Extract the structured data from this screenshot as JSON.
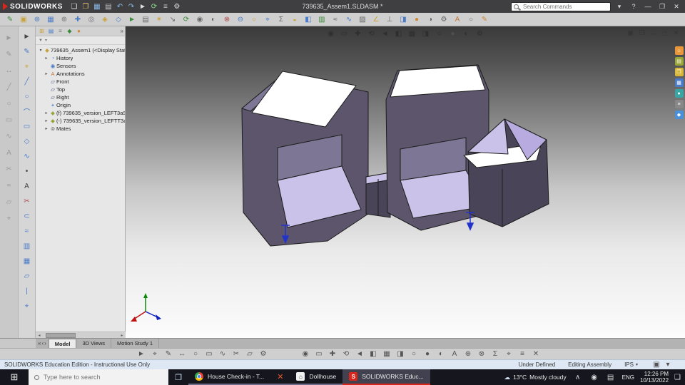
{
  "titlebar": {
    "doc_title": "739635_Assem1.SLDASM *",
    "app_name": "SOLIDWORKS",
    "search_placeholder": "Search Commands",
    "search_caret": "▾",
    "help": "?",
    "win_min": "—",
    "win_max": "❐",
    "win_close": "✕"
  },
  "toolbars": {
    "titlebar": [
      {
        "n": "new-file",
        "g": "❏",
        "c": "#e0e0e0"
      },
      {
        "n": "open-file",
        "g": "❐",
        "c": "#e8c87a"
      },
      {
        "n": "save",
        "g": "▦",
        "c": "#8ab8e8"
      },
      {
        "n": "print",
        "g": "▤",
        "c": "#c8c8c8"
      },
      {
        "n": "undo",
        "g": "↶",
        "c": "#8ab8e8"
      },
      {
        "n": "redo",
        "g": "↷",
        "c": "#8ab8e8"
      },
      {
        "n": "select",
        "g": "►",
        "c": "#e0e0e0"
      },
      {
        "n": "rebuild",
        "g": "⟳",
        "c": "#8adb8a"
      },
      {
        "n": "file-properties",
        "g": "≡",
        "c": "#c8c8c8"
      },
      {
        "n": "options",
        "g": "⚙",
        "c": "#d8d8d8"
      }
    ],
    "main": [
      {
        "n": "edit-component",
        "g": "✎",
        "c": "#3a8a3a"
      },
      {
        "n": "insert-components",
        "g": "▣",
        "c": "#caa23a"
      },
      {
        "n": "mate",
        "g": "⊚",
        "c": "#4a7bc7"
      },
      {
        "n": "linear-component-pattern",
        "g": "▦",
        "c": "#4a7bc7"
      },
      {
        "n": "smart-fasteners",
        "g": "⊕",
        "c": "#777"
      },
      {
        "n": "move-component",
        "g": "✚",
        "c": "#4a7bc7"
      },
      {
        "n": "show-hidden-components",
        "g": "◎",
        "c": "#777"
      },
      {
        "n": "assembly-features",
        "g": "◈",
        "c": "#caa23a"
      },
      {
        "n": "reference-geometry",
        "g": "◇",
        "c": "#4a7bc7"
      },
      {
        "n": "new-motion-study",
        "g": "►",
        "c": "#3a8a3a"
      },
      {
        "n": "bill-of-materials",
        "g": "▤",
        "c": "#666"
      },
      {
        "n": "exploded-view",
        "g": "✶",
        "c": "#caa23a"
      },
      {
        "n": "instant3d",
        "g": "↘",
        "c": "#666"
      },
      {
        "n": "update",
        "g": "⟳",
        "c": "#3a8a3a"
      },
      {
        "n": "take-snapshot",
        "g": "◉",
        "c": "#666"
      },
      {
        "n": "large-design-review",
        "g": "◐",
        "c": "#666"
      },
      {
        "n": "interference-detection",
        "g": "⊗",
        "c": "#b34a4a"
      },
      {
        "n": "clearance-verification",
        "g": "⊖",
        "c": "#4a7bc7"
      },
      {
        "n": "hole-alignment",
        "g": "○",
        "c": "#caa23a"
      },
      {
        "n": "measure",
        "g": "⌖",
        "c": "#4a7bc7"
      },
      {
        "n": "mass-properties",
        "g": "Σ",
        "c": "#666"
      },
      {
        "n": "sensor",
        "g": "◒",
        "c": "#caa23a"
      },
      {
        "n": "section-view",
        "g": "◧",
        "c": "#4a7bc7"
      },
      {
        "n": "assembly-visualization",
        "g": "▥",
        "c": "#3a8a3a"
      },
      {
        "n": "performance-evaluation",
        "g": "≈",
        "c": "#666"
      },
      {
        "n": "curvature",
        "g": "∿",
        "c": "#4a7bc7"
      },
      {
        "n": "zebra-stripes",
        "g": "▨",
        "c": "#666"
      },
      {
        "n": "draft-analysis",
        "g": "∠",
        "c": "#caa23a"
      },
      {
        "n": "undercut-analysis",
        "g": "⊥",
        "c": "#666"
      },
      {
        "n": "symmetry-check",
        "g": "◨",
        "c": "#4a7bc7"
      },
      {
        "n": "appearances",
        "g": "●",
        "c": "#cc8a3a"
      },
      {
        "n": "apply-scene",
        "g": "◑",
        "c": "#666"
      },
      {
        "n": "view-settings",
        "g": "⚙",
        "c": "#666"
      },
      {
        "n": "annotations",
        "g": "A",
        "c": "#c77b3a"
      },
      {
        "n": "hide-show-items",
        "g": "○",
        "c": "#666"
      },
      {
        "n": "edit-appearance",
        "g": "✎",
        "c": "#cc8a3a"
      }
    ],
    "hud": [
      {
        "n": "zoom-fit",
        "g": "◉",
        "c": "#2e2e2e"
      },
      {
        "n": "zoom-area",
        "g": "▭",
        "c": "#2e2e2e"
      },
      {
        "n": "pan",
        "g": "✚",
        "c": "#2e2e2e"
      },
      {
        "n": "rotate-view",
        "g": "⟲",
        "c": "#2e2e2e"
      },
      {
        "n": "previous-view",
        "g": "◄",
        "c": "#2e2e2e"
      },
      {
        "n": "section-view",
        "g": "◧",
        "c": "#2e2e2e"
      },
      {
        "n": "view-orientation",
        "g": "▦",
        "c": "#2e2e2e"
      },
      {
        "n": "display-style",
        "g": "◨",
        "c": "#2e2e2e"
      },
      {
        "n": "hide-show-items",
        "g": "○",
        "c": "#2e2e2e"
      },
      {
        "n": "edit-appearance",
        "g": "●",
        "c": "#4e4e4e"
      },
      {
        "n": "apply-scene",
        "g": "◐",
        "c": "#2e2e2e"
      },
      {
        "n": "view-settings",
        "g": "⚙",
        "c": "#2e2e2e"
      }
    ],
    "docwin": [
      {
        "n": "win-menu",
        "g": "▣",
        "c": "#333"
      },
      {
        "n": "win-restore",
        "g": "❐",
        "c": "#333"
      },
      {
        "n": "win-minimize",
        "g": "—",
        "c": "#333"
      },
      {
        "n": "win-maximize",
        "g": "□",
        "c": "#333"
      },
      {
        "n": "win-close",
        "g": "✕",
        "c": "#333"
      }
    ],
    "taskpane": [
      {
        "n": "sw-resources",
        "g": "⌂",
        "bg": "#e8983a"
      },
      {
        "n": "design-library",
        "g": "▤",
        "bg": "#9aa53a"
      },
      {
        "n": "file-explorer",
        "g": "❐",
        "bg": "#d8b83a"
      },
      {
        "n": "view-palette",
        "g": "▦",
        "bg": "#4a7bc7"
      },
      {
        "n": "appearances-scenes",
        "g": "●",
        "bg": "#3aa5a5"
      },
      {
        "n": "custom-properties",
        "g": "≡",
        "bg": "#888"
      },
      {
        "n": "sw-forum",
        "g": "◆",
        "bg": "#4a90d8"
      }
    ],
    "left_outer": [
      {
        "n": "select-disabled",
        "g": "►",
        "c": "#9a9a9a"
      },
      {
        "n": "sketch-disabled",
        "g": "✎",
        "c": "#9a9a9a"
      },
      {
        "n": "dimension-disabled",
        "g": "↔",
        "c": "#9a9a9a"
      },
      {
        "n": "line-disabled",
        "g": "╱",
        "c": "#9a9a9a"
      },
      {
        "n": "circle-disabled",
        "g": "○",
        "c": "#9a9a9a"
      },
      {
        "n": "rectangle-disabled",
        "g": "▭",
        "c": "#9a9a9a"
      },
      {
        "n": "spline-disabled",
        "g": "∿",
        "c": "#9a9a9a"
      },
      {
        "n": "text-disabled",
        "g": "A",
        "c": "#9a9a9a"
      },
      {
        "n": "trim-disabled",
        "g": "✂",
        "c": "#9a9a9a"
      },
      {
        "n": "offset-disabled",
        "g": "≈",
        "c": "#9a9a9a"
      },
      {
        "n": "plane-disabled",
        "g": "▱",
        "c": "#9a9a9a"
      },
      {
        "n": "point-disabled",
        "g": "⌖",
        "c": "#9a9a9a"
      }
    ],
    "left_inner": [
      {
        "n": "select-tool",
        "g": "►",
        "c": "#444"
      },
      {
        "n": "sketch",
        "g": "✎",
        "c": "#4a7bc7"
      },
      {
        "n": "smart-dimension",
        "g": "⌖",
        "c": "#caa23a"
      },
      {
        "n": "line",
        "g": "╱",
        "c": "#4a7bc7"
      },
      {
        "n": "circle",
        "g": "○",
        "c": "#4a7bc7"
      },
      {
        "n": "arc",
        "g": "⌒",
        "c": "#4a7bc7"
      },
      {
        "n": "rectangle",
        "g": "▭",
        "c": "#4a7bc7"
      },
      {
        "n": "polygon",
        "g": "◇",
        "c": "#4a7bc7"
      },
      {
        "n": "spline",
        "g": "∿",
        "c": "#4a7bc7"
      },
      {
        "n": "point",
        "g": "•",
        "c": "#444"
      },
      {
        "n": "text",
        "g": "A",
        "c": "#444"
      },
      {
        "n": "trim-entities",
        "g": "✂",
        "c": "#b34a4a"
      },
      {
        "n": "convert-entities",
        "g": "⊂",
        "c": "#4a7bc7"
      },
      {
        "n": "offset-entities",
        "g": "≈",
        "c": "#4a7bc7"
      },
      {
        "n": "mirror-entities",
        "g": "▥",
        "c": "#4a7bc7"
      },
      {
        "n": "sketch-pattern",
        "g": "▦",
        "c": "#4a7bc7"
      },
      {
        "n": "plane",
        "g": "▱",
        "c": "#4a7bc7"
      },
      {
        "n": "axis",
        "g": "|",
        "c": "#4a7bc7"
      },
      {
        "n": "coordinate-system",
        "g": "⌖",
        "c": "#4a7bc7"
      }
    ],
    "bottom_left": [
      {
        "n": "select",
        "g": "►",
        "c": "#555"
      },
      {
        "n": "measure",
        "g": "⌖",
        "c": "#555"
      },
      {
        "n": "sketch",
        "g": "✎",
        "c": "#555"
      },
      {
        "n": "dimension",
        "g": "↔",
        "c": "#555"
      },
      {
        "n": "circle",
        "g": "○",
        "c": "#555"
      },
      {
        "n": "rectangle",
        "g": "▭",
        "c": "#555"
      },
      {
        "n": "spline",
        "g": "∿",
        "c": "#555"
      },
      {
        "n": "trim",
        "g": "✂",
        "c": "#555"
      },
      {
        "n": "plane",
        "g": "▱",
        "c": "#555"
      },
      {
        "n": "settings",
        "g": "⚙",
        "c": "#555"
      }
    ],
    "bottom_right": [
      {
        "n": "zoom-fit",
        "g": "◉",
        "c": "#555"
      },
      {
        "n": "zoom-area",
        "g": "▭",
        "c": "#555"
      },
      {
        "n": "pan",
        "g": "✚",
        "c": "#555"
      },
      {
        "n": "rotate",
        "g": "⟲",
        "c": "#555"
      },
      {
        "n": "previous-view",
        "g": "◄",
        "c": "#555"
      },
      {
        "n": "section",
        "g": "◧",
        "c": "#555"
      },
      {
        "n": "orientation",
        "g": "▦",
        "c": "#555"
      },
      {
        "n": "display-style",
        "g": "◨",
        "c": "#555"
      },
      {
        "n": "hide-show",
        "g": "○",
        "c": "#555"
      },
      {
        "n": "appearance",
        "g": "●",
        "c": "#555"
      },
      {
        "n": "scene",
        "g": "◐",
        "c": "#555"
      },
      {
        "n": "annotation",
        "g": "A",
        "c": "#555"
      },
      {
        "n": "add",
        "g": "⊕",
        "c": "#555"
      },
      {
        "n": "interference",
        "g": "⊗",
        "c": "#555"
      },
      {
        "n": "mass-props",
        "g": "Σ",
        "c": "#555"
      },
      {
        "n": "origin",
        "g": "⌖",
        "c": "#555"
      },
      {
        "n": "list",
        "g": "≡",
        "c": "#555"
      },
      {
        "n": "close",
        "g": "✕",
        "c": "#555"
      }
    ],
    "tree_tabs": [
      {
        "n": "feature-manager-tab",
        "g": "⊞",
        "c": "#caa23a"
      },
      {
        "n": "property-manager-tab",
        "g": "▤",
        "c": "#4a7bc7"
      },
      {
        "n": "configuration-manager-tab",
        "g": "≡",
        "c": "#777"
      },
      {
        "n": "dimxpert-manager-tab",
        "g": "◆",
        "c": "#3a8a3a"
      },
      {
        "n": "display-manager-tab",
        "g": "●",
        "c": "#cc8a3a"
      }
    ],
    "tray_icons": [
      {
        "n": "tray-expand",
        "g": "∧",
        "c": "#ddd"
      },
      {
        "n": "volume",
        "g": "◉",
        "c": "#ddd"
      },
      {
        "n": "network",
        "g": "▤",
        "c": "#ddd"
      }
    ],
    "statusbar_icons": [
      {
        "n": "status-extra",
        "g": "▣",
        "c": "#555"
      },
      {
        "n": "status-caret",
        "g": "▾",
        "c": "#555"
      }
    ]
  },
  "panel": {
    "tabs_overflow": "»",
    "filter_funnel": "▼",
    "filter_caret": "▾",
    "scroll_left": "◂",
    "scroll_right": "▸"
  },
  "feature_tree": {
    "items": [
      {
        "caret": "▾",
        "g": "◆",
        "c": "#caa23a",
        "label": "739635_Assem1  (<Display Stat",
        "indent": 0
      },
      {
        "caret": "▸",
        "g": "◔",
        "c": "#4a7bc7",
        "label": "History",
        "indent": 1
      },
      {
        "caret": "",
        "g": "◉",
        "c": "#4a7bc7",
        "label": "Sensors",
        "indent": 1
      },
      {
        "caret": "▸",
        "g": "A",
        "c": "#c77b3a",
        "label": "Annotations",
        "indent": 1
      },
      {
        "caret": "",
        "g": "▱",
        "c": "#55648a",
        "label": "Front",
        "indent": 1
      },
      {
        "caret": "",
        "g": "▱",
        "c": "#55648a",
        "label": "Top",
        "indent": 1
      },
      {
        "caret": "",
        "g": "▱",
        "c": "#55648a",
        "label": "Right",
        "indent": 1
      },
      {
        "caret": "",
        "g": "⌖",
        "c": "#4a7bc7",
        "label": "Origin",
        "indent": 1
      },
      {
        "caret": "▸",
        "g": "◆",
        "c": "#9aa53a",
        "label": "(f) 739635_version_LEFT3aS",
        "indent": 1
      },
      {
        "caret": "▸",
        "g": "◆",
        "c": "#9aa53a",
        "label": "(-) 739635_version_LEFTT3a",
        "indent": 1
      },
      {
        "caret": "▸",
        "g": "⊚",
        "c": "#666",
        "label": "Mates",
        "indent": 1
      }
    ]
  },
  "tabs": {
    "nav": [
      "«",
      "‹",
      "›"
    ],
    "items": [
      {
        "label": "Model",
        "active": true
      },
      {
        "label": "3D Views",
        "active": false
      },
      {
        "label": "Motion Study 1",
        "active": false
      }
    ]
  },
  "statusbar": {
    "left": "SOLIDWORKS Education Edition - Instructional Use Only",
    "under_defined": "Under Defined",
    "editing": "Editing Assembly",
    "units": "IPS",
    "units_caret": "▾"
  },
  "taskbar": {
    "start_glyph": "⊞",
    "search_placeholder": "Type here to search",
    "taskview_glyph": "❐",
    "tasks": [
      {
        "name": "chrome",
        "type": "chrome",
        "glyph": "",
        "fg": "",
        "bg": "",
        "label": "House Check-in - T...",
        "active": false
      },
      {
        "name": "x-app",
        "type": "glyph",
        "glyph": "✕",
        "fg": "#e8552c",
        "bg": "",
        "label": "",
        "active": false
      },
      {
        "name": "dollhouse",
        "type": "square",
        "glyph": "⌂",
        "fg": "#333",
        "bg": "#f2f2f2",
        "label": "Dollhouse",
        "active": false
      },
      {
        "name": "solidworks",
        "type": "square",
        "glyph": "S",
        "fg": "#fff",
        "bg": "#d9261c",
        "label": "SOLIDWORKS Educ...",
        "active": true
      }
    ],
    "tray": {
      "weather_glyph": "☁",
      "weather_temp": "13°C",
      "weather_text": "Mostly cloudy",
      "lang": "ENG",
      "time": "12:26 PM",
      "date": "10/13/2022",
      "notification_glyph": "❑"
    }
  },
  "model": {
    "palette": {
      "wall-dark": "#4a4458",
      "wall-mid": "#5c556b",
      "wall-light": "#7d7694",
      "floor": "#cbc2ea",
      "floor2": "#b7abdf",
      "roof": "#ffffff",
      "edge": "#1d1d1d",
      "mate-arrow": "#2233cc",
      "axis-x": "#c01010",
      "axis-y": "#0a8a0a",
      "axis-z": "#1020c0"
    }
  }
}
